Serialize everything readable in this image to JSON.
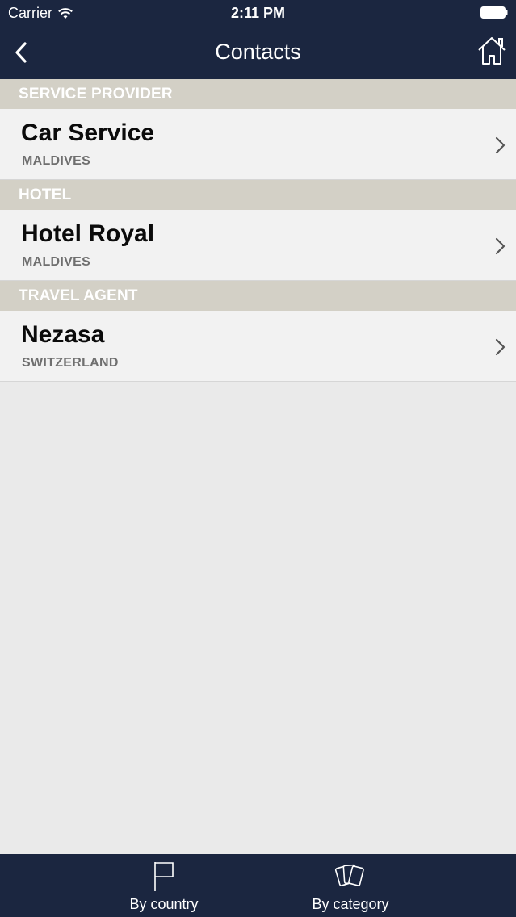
{
  "status_bar": {
    "carrier": "Carrier",
    "time": "2:11 PM"
  },
  "nav": {
    "title": "Contacts"
  },
  "sections": [
    {
      "header": "SERVICE PROVIDER",
      "items": [
        {
          "name": "Car Service",
          "country": "MALDIVES"
        }
      ]
    },
    {
      "header": "HOTEL",
      "items": [
        {
          "name": "Hotel Royal",
          "country": "MALDIVES"
        }
      ]
    },
    {
      "header": "TRAVEL AGENT",
      "items": [
        {
          "name": "Nezasa",
          "country": "SWITZERLAND"
        }
      ]
    }
  ],
  "tabbar": {
    "by_country": "By country",
    "by_category": "By category"
  },
  "colors": {
    "nav_bg": "#1b2640",
    "section_header_bg": "#d3d0c6",
    "row_bg": "#f2f2f2",
    "page_bg": "#eaeaea"
  },
  "icons": {
    "back": "chevron-left-icon",
    "home": "home-icon",
    "row_disclosure": "chevron-right-icon",
    "by_country": "flag-icon",
    "by_category": "cards-icon"
  }
}
